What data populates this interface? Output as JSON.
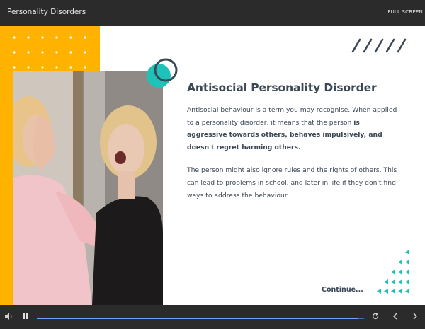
{
  "window": {
    "title": "Personality Disorders",
    "fullscreen_label": "FULL SCREEN"
  },
  "slide": {
    "heading": "Antisocial Personality Disorder",
    "paragraph1_plain": "Antisocial behaviour is a term you may recognise. When applied to a personality disorder, it means that the person ",
    "paragraph1_bold": "is aggressive towards others, behaves impulsively, and doesn't regret harming others.",
    "paragraph2": "The person might also ignore rules and the rights of others. This can lead to problems in school, and later in life if they don't find ways to address the behaviour.",
    "continue_label": "Continue..."
  },
  "colors": {
    "accent_yellow": "#ffb300",
    "accent_teal": "#1fc2b8",
    "text_dark": "#3b4856",
    "chrome_bg": "#2b2b2b"
  },
  "player": {
    "progress": 0.98,
    "icons": [
      "volume-icon",
      "pause-icon",
      "replay-icon",
      "previous-icon",
      "next-icon"
    ]
  }
}
